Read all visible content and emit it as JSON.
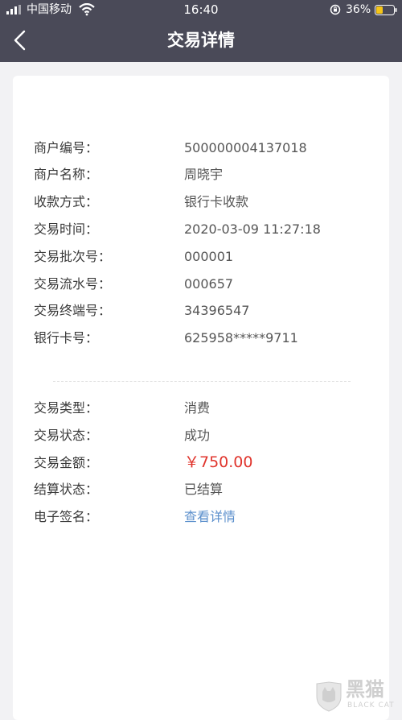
{
  "status_bar": {
    "carrier": "中国移动",
    "time": "16:40",
    "battery_percent": "36%",
    "icons": [
      "signal-icon",
      "wifi-icon",
      "orientation-lock-icon",
      "battery-icon"
    ]
  },
  "nav": {
    "title": "交易详情",
    "back_icon": "back-chevron-icon"
  },
  "details": [
    {
      "label": "商户编号：",
      "value": "500000004137018"
    },
    {
      "label": "商户名称：",
      "value": "周晓宇"
    },
    {
      "label": "收款方式：",
      "value": "银行卡收款"
    },
    {
      "label": "交易时间：",
      "value": "2020-03-09 11:27:18"
    },
    {
      "label": "交易批次号：",
      "value": "000001"
    },
    {
      "label": "交易流水号：",
      "value": "000657"
    },
    {
      "label": "交易终端号：",
      "value": "34396547"
    },
    {
      "label": "银行卡号：",
      "value": "625958*****9711"
    }
  ],
  "summary": [
    {
      "label": "交易类型：",
      "value": "消费"
    },
    {
      "label": "交易状态：",
      "value": "成功"
    },
    {
      "label": "交易金额：",
      "value": "￥750.00"
    },
    {
      "label": "结算状态：",
      "value": "已结算"
    },
    {
      "label": "电子签名：",
      "value": "查看详情"
    }
  ],
  "colors": {
    "header_bg": "#4a4a58",
    "amount": "#e0342c",
    "link": "#5b8fcc"
  },
  "watermark": {
    "text": "黑猫",
    "sub": "BLACK CAT"
  }
}
